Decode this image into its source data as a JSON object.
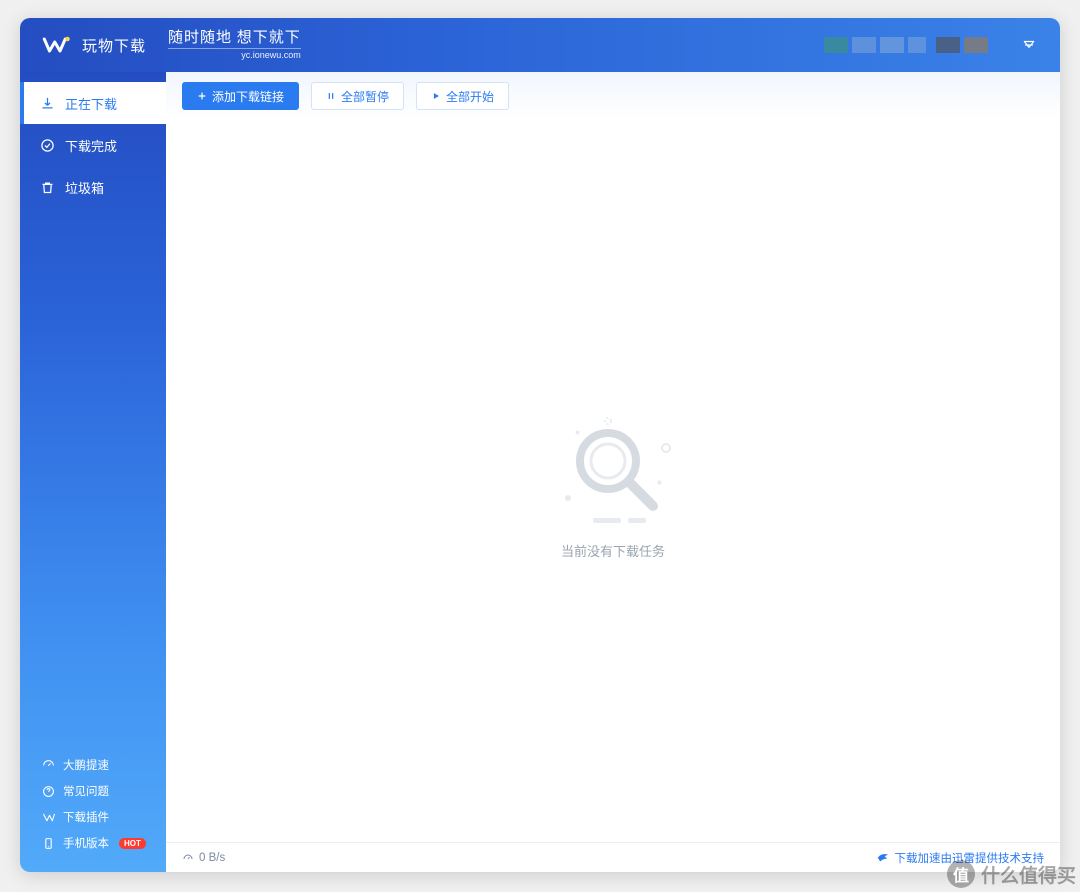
{
  "header": {
    "app_title": "玩物下载",
    "slogan": "随时随地 想下就下",
    "slogan_sub": "yc.ionewu.com"
  },
  "sidebar": {
    "items": [
      {
        "label": "正在下载",
        "icon": "download",
        "active": true
      },
      {
        "label": "下载完成",
        "icon": "check-circle",
        "active": false
      },
      {
        "label": "垃圾箱",
        "icon": "trash",
        "active": false
      }
    ],
    "bottom_items": [
      {
        "label": "大鹏提速",
        "icon": "speed"
      },
      {
        "label": "常见问题",
        "icon": "question"
      },
      {
        "label": "下载插件",
        "icon": "plugin"
      },
      {
        "label": "手机版本",
        "icon": "phone",
        "hot": "HOT"
      }
    ]
  },
  "toolbar": {
    "add_link_label": "添加下载链接",
    "pause_all_label": "全部暂停",
    "start_all_label": "全部开始"
  },
  "empty_state": {
    "text": "当前没有下载任务"
  },
  "statusbar": {
    "speed": "0 B/s",
    "xunlei_text": "下载加速由迅雷提供技术支持"
  },
  "watermark": {
    "circle": "值",
    "text": "什么值得买"
  },
  "colors": {
    "primary": "#2b7bf0",
    "sidebar_top": "#244dc1",
    "sidebar_bottom": "#52aaf9",
    "hot_badge": "#ff3b30"
  }
}
